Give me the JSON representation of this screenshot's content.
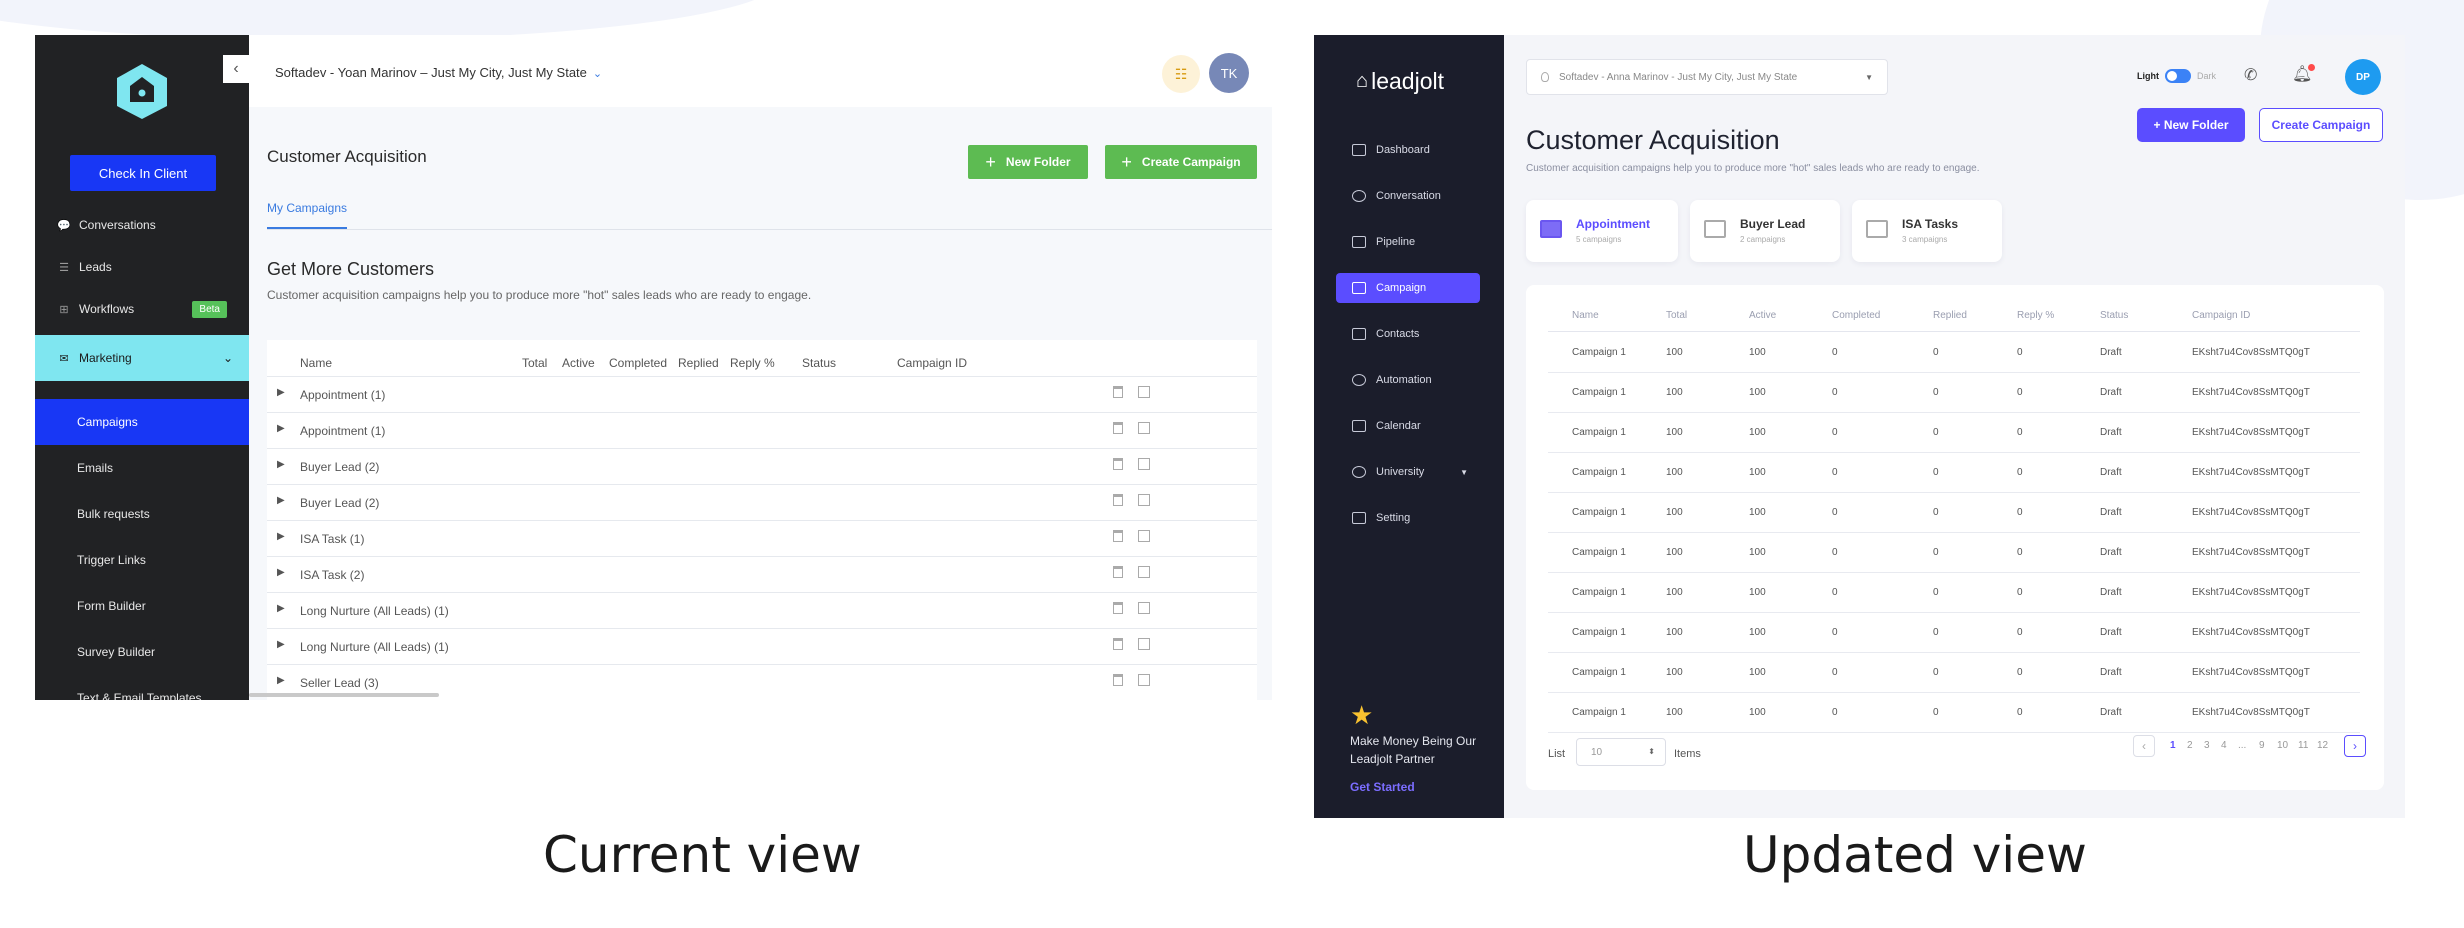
{
  "current": {
    "caption": "Current view",
    "workspace": "Softadev - Yoan Marinov – Just My City, Just My State",
    "avatar": "TK",
    "check_in": "Check In Client",
    "nav": [
      {
        "label": "Conversations"
      },
      {
        "label": "Leads"
      },
      {
        "label": "Workflows",
        "badge": "Beta"
      },
      {
        "label": "Marketing"
      }
    ],
    "subnav": [
      "Campaigns",
      "Emails",
      "Bulk requests",
      "Trigger Links",
      "Form Builder",
      "Survey Builder",
      "Text & Email Templates"
    ],
    "page_title": "Customer Acquisition",
    "new_folder": "New Folder",
    "create_campaign": "Create Campaign",
    "tab": "My Campaigns",
    "section_title": "Get More Customers",
    "section_desc": "Customer acquisition campaigns help you to produce more \"hot\" sales leads who are ready to engage.",
    "columns": [
      "Name",
      "Total",
      "Active",
      "Completed",
      "Replied",
      "Reply %",
      "Status",
      "Campaign ID"
    ],
    "rows": [
      "Appointment (1)",
      "Appointment (1)",
      "Buyer Lead (2)",
      "Buyer Lead (2)",
      "ISA Task (1)",
      "ISA Task (2)",
      "Long Nurture (All Leads) (1)",
      "Long Nurture (All Leads) (1)",
      "Seller Lead  (3)"
    ]
  },
  "updated": {
    "caption": "Updated view",
    "logo": "leadjolt",
    "workspace": "Softadev - Anna Marinov - Just My City, Just My State",
    "theme_light": "Light",
    "theme_dark": "Dark",
    "avatar": "DP",
    "nav": [
      "Dashboard",
      "Conversation",
      "Pipeline",
      "Campaign",
      "Contacts",
      "Automation",
      "Calendar",
      "University",
      "Setting"
    ],
    "promo": "Make Money Being Our Leadjolt Partner",
    "get_started": "Get Started",
    "page_title": "Customer Acquisition",
    "page_desc": "Customer acquisition campaigns help you to produce more \"hot\" sales leads who are ready to engage.",
    "new_folder": "+ New Folder",
    "create_campaign": "Create Campaign",
    "cards": [
      {
        "name": "Appointment",
        "sub": "5 campaigns"
      },
      {
        "name": "Buyer Lead",
        "sub": "2 campaigns"
      },
      {
        "name": "ISA Tasks",
        "sub": "3 campaigns"
      }
    ],
    "columns": [
      "Name",
      "Total",
      "Active",
      "Completed",
      "Replied",
      "Reply %",
      "Status",
      "Campaign ID"
    ],
    "rows": [
      [
        "Campaign 1",
        "100",
        "100",
        "0",
        "0",
        "0",
        "Draft",
        "EKsht7u4Cov8SsMTQ0gT"
      ],
      [
        "Campaign 1",
        "100",
        "100",
        "0",
        "0",
        "0",
        "Draft",
        "EKsht7u4Cov8SsMTQ0gT"
      ],
      [
        "Campaign 1",
        "100",
        "100",
        "0",
        "0",
        "0",
        "Draft",
        "EKsht7u4Cov8SsMTQ0gT"
      ],
      [
        "Campaign 1",
        "100",
        "100",
        "0",
        "0",
        "0",
        "Draft",
        "EKsht7u4Cov8SsMTQ0gT"
      ],
      [
        "Campaign 1",
        "100",
        "100",
        "0",
        "0",
        "0",
        "Draft",
        "EKsht7u4Cov8SsMTQ0gT"
      ],
      [
        "Campaign 1",
        "100",
        "100",
        "0",
        "0",
        "0",
        "Draft",
        "EKsht7u4Cov8SsMTQ0gT"
      ],
      [
        "Campaign 1",
        "100",
        "100",
        "0",
        "0",
        "0",
        "Draft",
        "EKsht7u4Cov8SsMTQ0gT"
      ],
      [
        "Campaign 1",
        "100",
        "100",
        "0",
        "0",
        "0",
        "Draft",
        "EKsht7u4Cov8SsMTQ0gT"
      ],
      [
        "Campaign 1",
        "100",
        "100",
        "0",
        "0",
        "0",
        "Draft",
        "EKsht7u4Cov8SsMTQ0gT"
      ],
      [
        "Campaign 1",
        "100",
        "100",
        "0",
        "0",
        "0",
        "Draft",
        "EKsht7u4Cov8SsMTQ0gT"
      ]
    ],
    "list_label": "List",
    "list_value": "10",
    "items_label": "Items",
    "pages": [
      "1",
      "2",
      "3",
      "4",
      "...",
      "9",
      "10",
      "11",
      "12"
    ]
  }
}
